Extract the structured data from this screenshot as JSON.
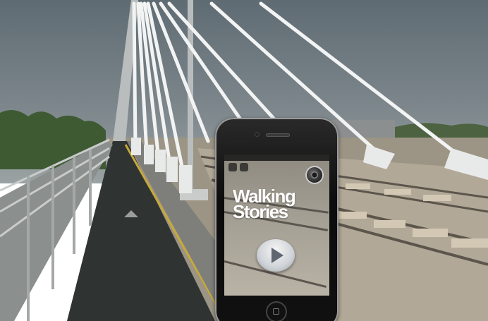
{
  "app": {
    "title_line1": "Walking",
    "title_line2": "Stories",
    "chip_left": "",
    "chip_right": "",
    "status_text": ""
  },
  "icons": {
    "camera": "camera-icon",
    "play": "play-icon",
    "home": "home-button-icon"
  },
  "colors": {
    "sky": "#6f7a82",
    "path": "#2f3332",
    "title_text": "#ffffff"
  }
}
